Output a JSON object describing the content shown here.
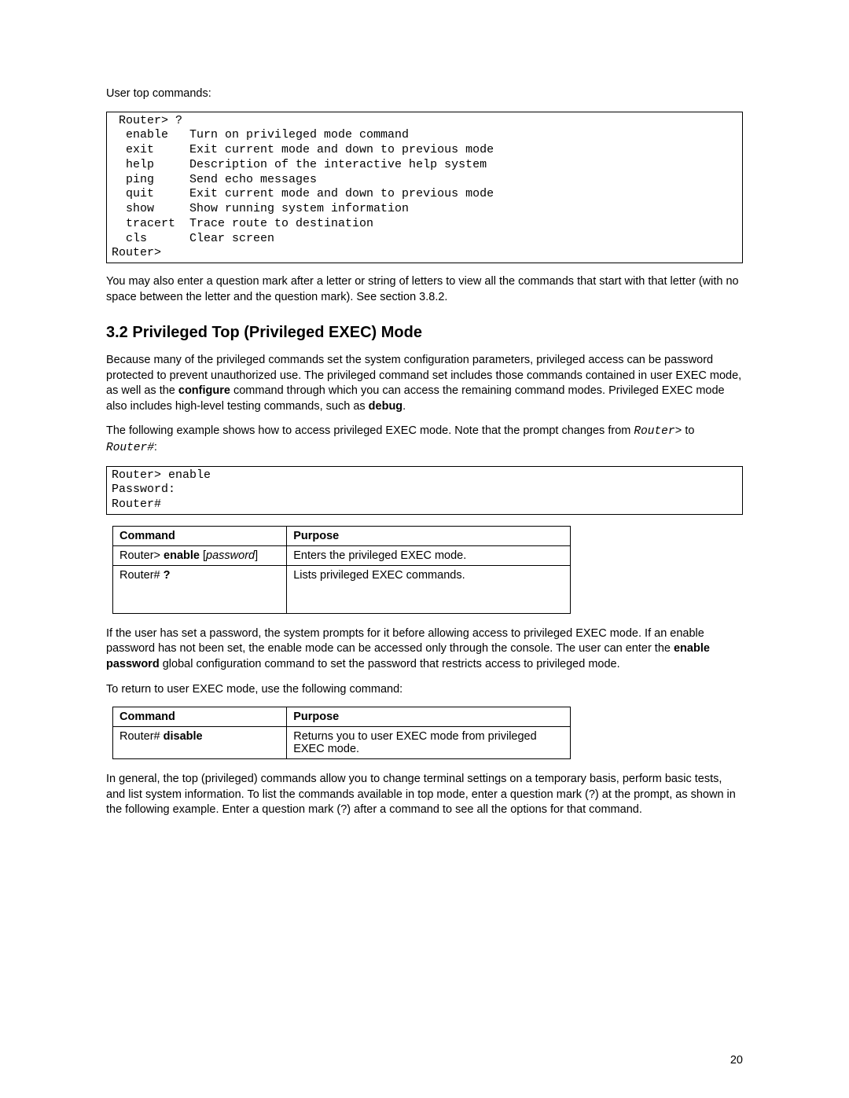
{
  "intro_para": "User top commands:",
  "code1": " Router> ?\n  enable   Turn on privileged mode command\n  exit     Exit current mode and down to previous mode\n  help     Description of the interactive help system\n  ping     Send echo messages\n  quit     Exit current mode and down to previous mode\n  show     Show running system information\n  tracert  Trace route to destination\n  cls      Clear screen\nRouter>",
  "para_after_code1": "You may also enter a question mark after a letter or string of letters to view all the commands that start with that letter (with no space between the letter and the question mark). See section 3.8.2.",
  "section_heading": "3.2 Privileged Top (Privileged EXEC) Mode",
  "priv_para_1a": "Because many of the privileged commands set the system configuration parameters, privileged access can be password protected to prevent unauthorized use. The privileged command set includes those commands contained in user EXEC mode, as well as the ",
  "priv_para_1_bold1": "configure",
  "priv_para_1b": " command through which you can access the remaining command modes. Privileged EXEC mode also includes high-level testing commands, such as ",
  "priv_para_1_bold2": "debug",
  "priv_para_1c": ".",
  "priv_para_2a": "The following example shows how to access privileged EXEC mode. Note that the prompt changes from ",
  "priv_para_2_m1": "Router>",
  "priv_para_2_mid": " to ",
  "priv_para_2_m2": "Router#",
  "priv_para_2b": ":",
  "code2": "Router> enable\nPassword:\nRouter#",
  "table1": {
    "h1": "Command",
    "h2": "Purpose",
    "r1c1_a": "Router> ",
    "r1c1_b": "enable",
    "r1c1_c": " [",
    "r1c1_d": "password",
    "r1c1_e": "]",
    "r1c2": "Enters the privileged EXEC mode.",
    "r2c1_a": "Router# ",
    "r2c1_b": "?",
    "r2c2": "Lists privileged EXEC commands."
  },
  "after_table1_a": "If the user has set a password, the system prompts for it before allowing access to privileged EXEC mode. If an enable password has not been set, the enable mode can be accessed only through the console. The user can enter the ",
  "after_table1_bold": "enable password",
  "after_table1_b": " global configuration command to set the password that restricts access to privileged mode.",
  "return_para": "To return to user EXEC mode, use the following command:",
  "table2": {
    "h1": "Command",
    "h2": "Purpose",
    "r1c1_a": "Router# ",
    "r1c1_b": "disable",
    "r1c2": "Returns you to user EXEC mode from privileged EXEC mode."
  },
  "final_para": "In general, the top (privileged) commands allow you to change terminal settings on a temporary basis, perform basic tests, and list system information. To list the commands available in top mode, enter a question mark (?) at the prompt, as shown in the following example. Enter a question mark (?) after a command to see all the options for that command.",
  "page_number": "20"
}
